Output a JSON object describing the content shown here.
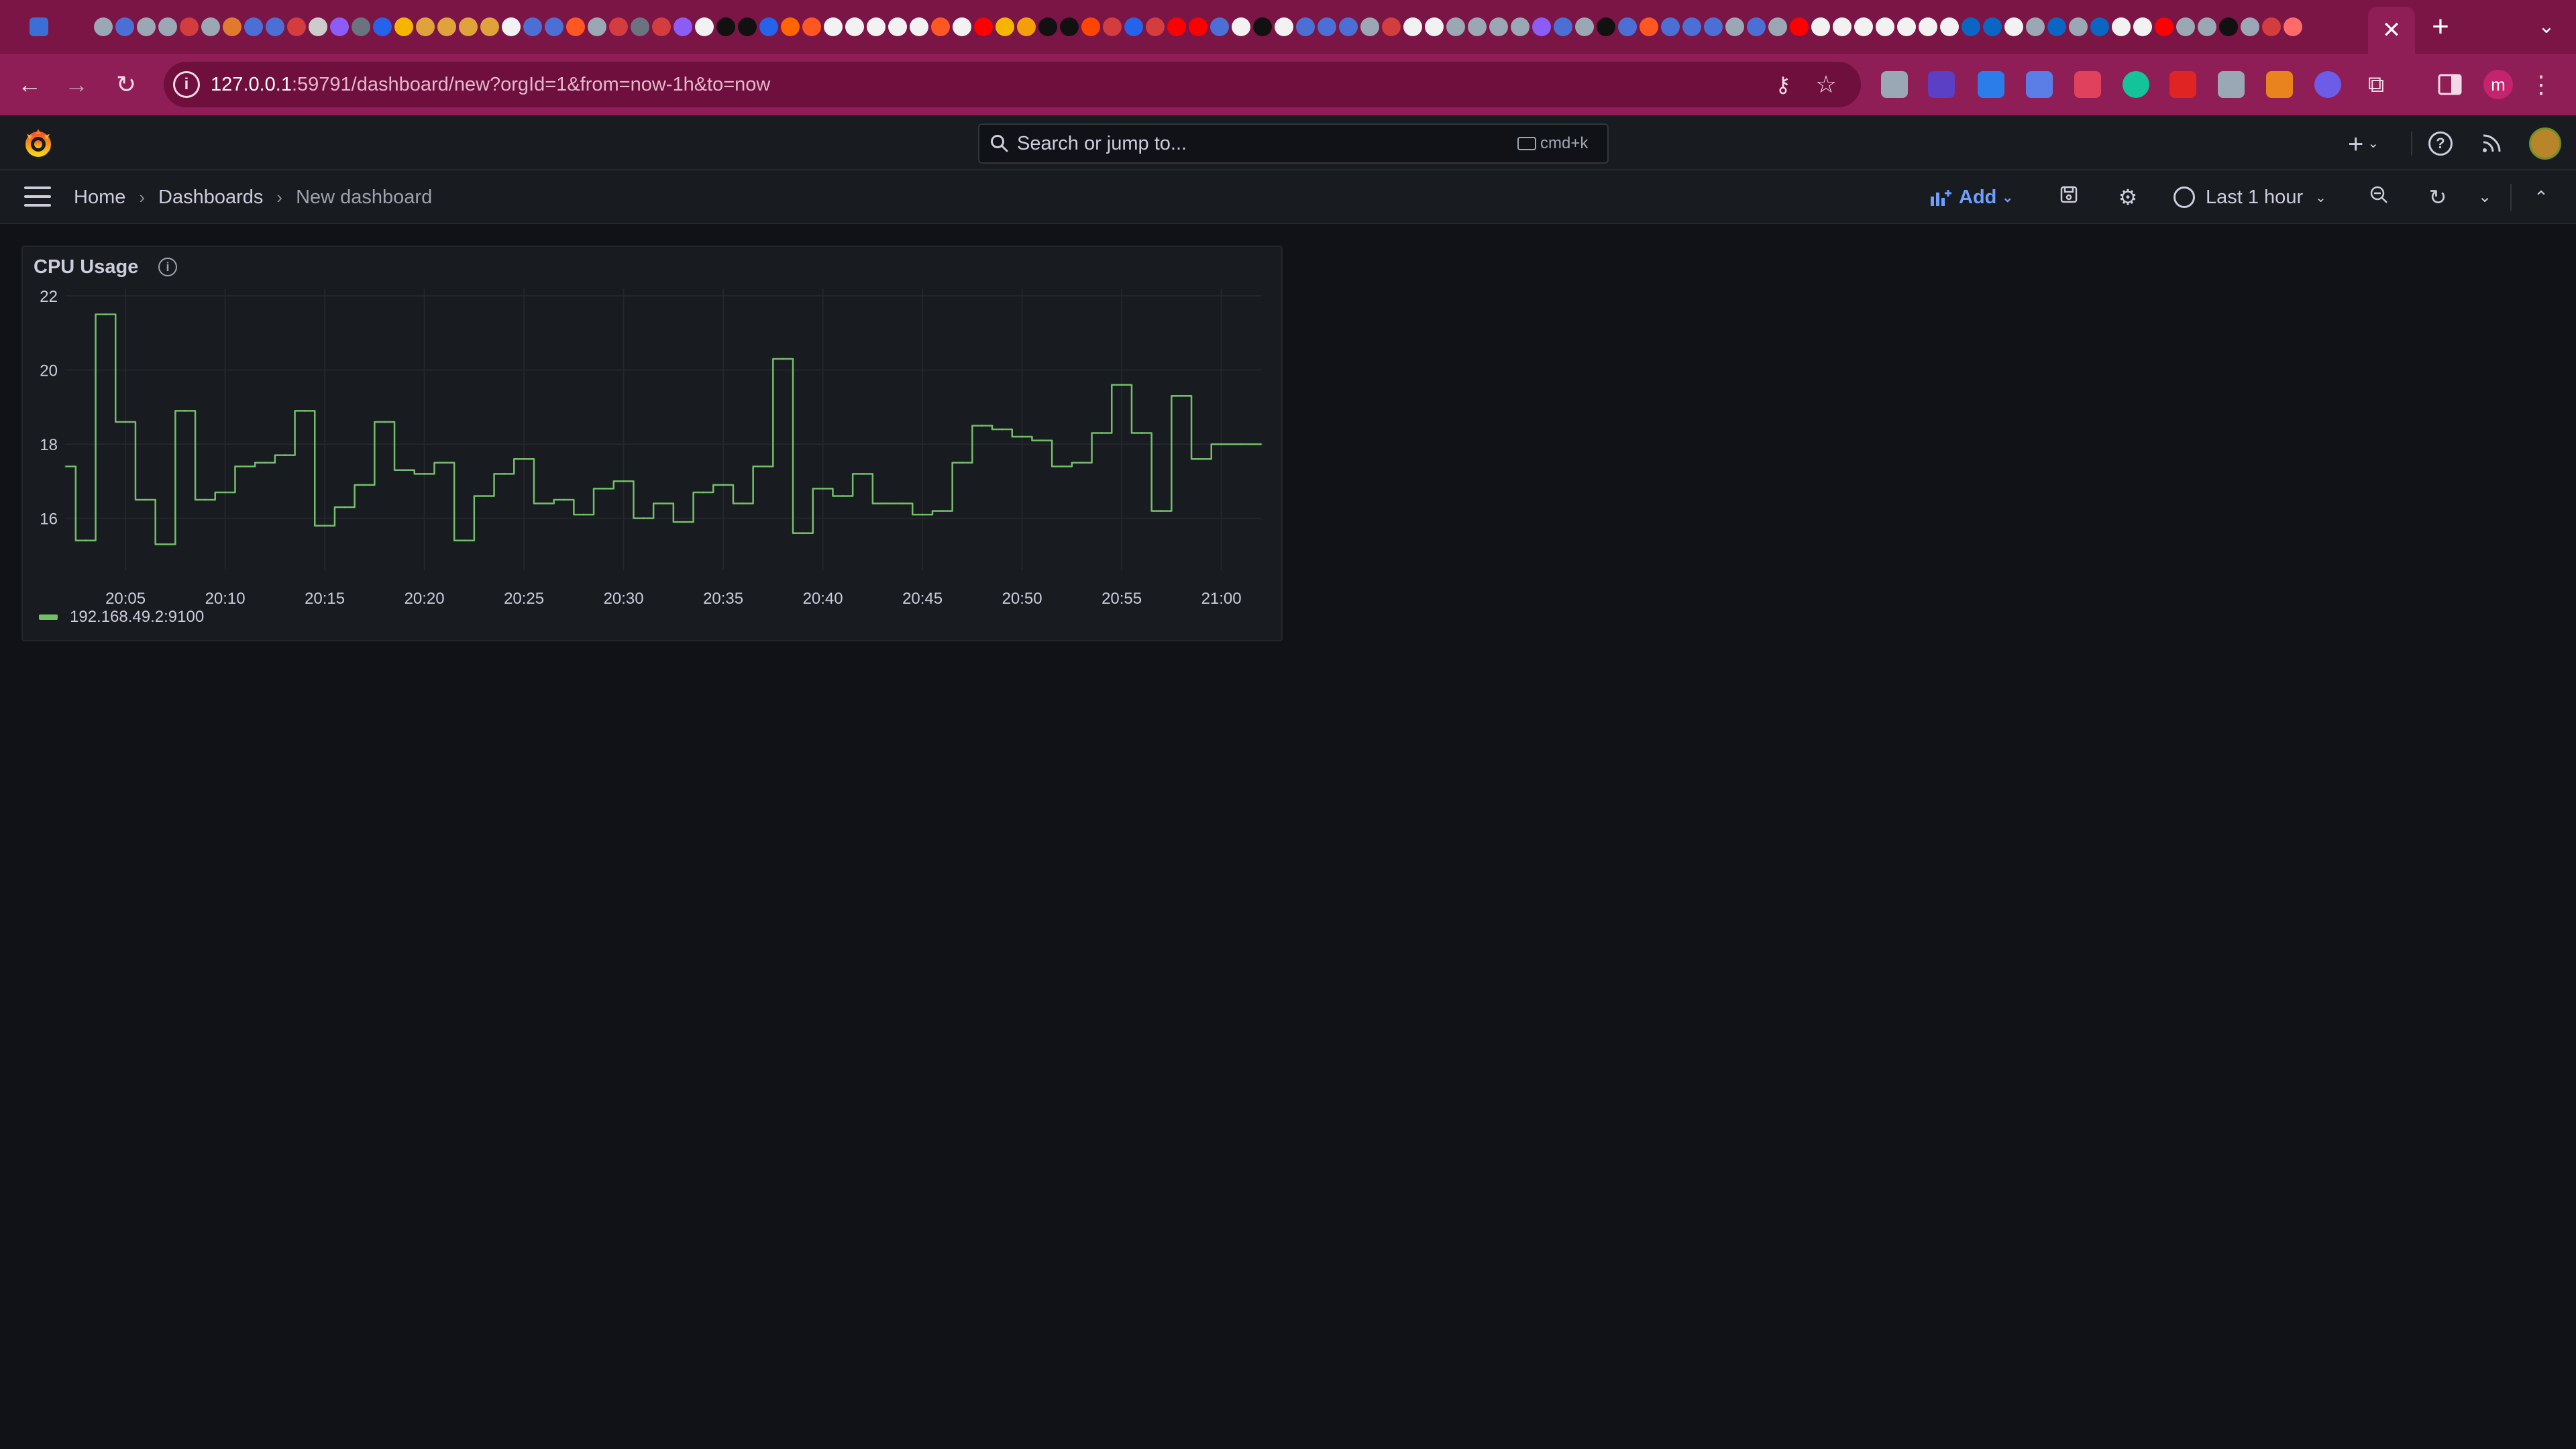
{
  "browser": {
    "url_host": "127.0.0.1",
    "url_path": ":59791/dashboard/new?orgId=1&from=now-1h&to=now",
    "profile_initial": "m",
    "tab_close": "✕"
  },
  "grafana": {
    "search_placeholder": "Search or jump to...",
    "search_shortcut": "cmd+k",
    "breadcrumbs": [
      "Home",
      "Dashboards",
      "New dashboard"
    ],
    "add_label": "Add",
    "time_range": "Last 1 hour"
  },
  "panel": {
    "title": "CPU Usage",
    "legend": "192.168.49.2:9100"
  },
  "colors": {
    "series": "#73bf69",
    "accent": "#6e9fff",
    "tabstrip": "#7a1546",
    "toolbar": "#8e1e55"
  },
  "chart_data": {
    "type": "line",
    "title": "CPU Usage",
    "xlabel": "",
    "ylabel": "",
    "ylim": [
      14.6,
      22.2
    ],
    "y_ticks": [
      16,
      18,
      20,
      22
    ],
    "x_ticks": [
      "20:05",
      "20:10",
      "20:15",
      "20:20",
      "20:25",
      "20:30",
      "20:35",
      "20:40",
      "20:45",
      "20:50",
      "20:55",
      "21:00"
    ],
    "x_range": [
      "20:02",
      "21:02"
    ],
    "grid": true,
    "legend": "bottom-left",
    "series": [
      {
        "name": "192.168.49.2:9100",
        "x": [
          "20:02",
          "20:03",
          "20:04",
          "20:05",
          "20:06",
          "20:07",
          "20:08",
          "20:09",
          "20:10",
          "20:11",
          "20:12",
          "20:13",
          "20:14",
          "20:15",
          "20:16",
          "20:17",
          "20:18",
          "20:19",
          "20:20",
          "20:21",
          "20:22",
          "20:23",
          "20:24",
          "20:25",
          "20:26",
          "20:27",
          "20:28",
          "20:29",
          "20:30",
          "20:31",
          "20:32",
          "20:33",
          "20:34",
          "20:35",
          "20:36",
          "20:37",
          "20:38",
          "20:39",
          "20:40",
          "20:41",
          "20:42",
          "20:43",
          "20:44",
          "20:45",
          "20:46",
          "20:47",
          "20:48",
          "20:49",
          "20:50",
          "20:51",
          "20:52",
          "20:53",
          "20:54",
          "20:55",
          "20:56",
          "20:57",
          "20:58",
          "20:59",
          "21:00",
          "21:01",
          "21:02"
        ],
        "values": [
          17.4,
          15.4,
          21.5,
          18.6,
          16.5,
          15.3,
          18.9,
          16.5,
          16.7,
          17.4,
          17.5,
          17.7,
          18.9,
          15.8,
          16.3,
          16.9,
          18.6,
          17.3,
          17.2,
          17.5,
          15.4,
          16.6,
          17.2,
          17.6,
          16.4,
          16.5,
          16.1,
          16.8,
          17.0,
          16.0,
          16.4,
          15.9,
          16.7,
          16.9,
          16.4,
          17.4,
          20.3,
          15.6,
          16.8,
          16.6,
          17.2,
          16.4,
          16.4,
          16.1,
          16.2,
          17.5,
          18.5,
          18.4,
          18.2,
          18.1,
          17.4,
          17.5,
          18.3,
          19.6,
          18.3,
          16.2,
          19.3,
          17.6,
          18.0,
          18.0,
          18.0
        ]
      }
    ]
  }
}
